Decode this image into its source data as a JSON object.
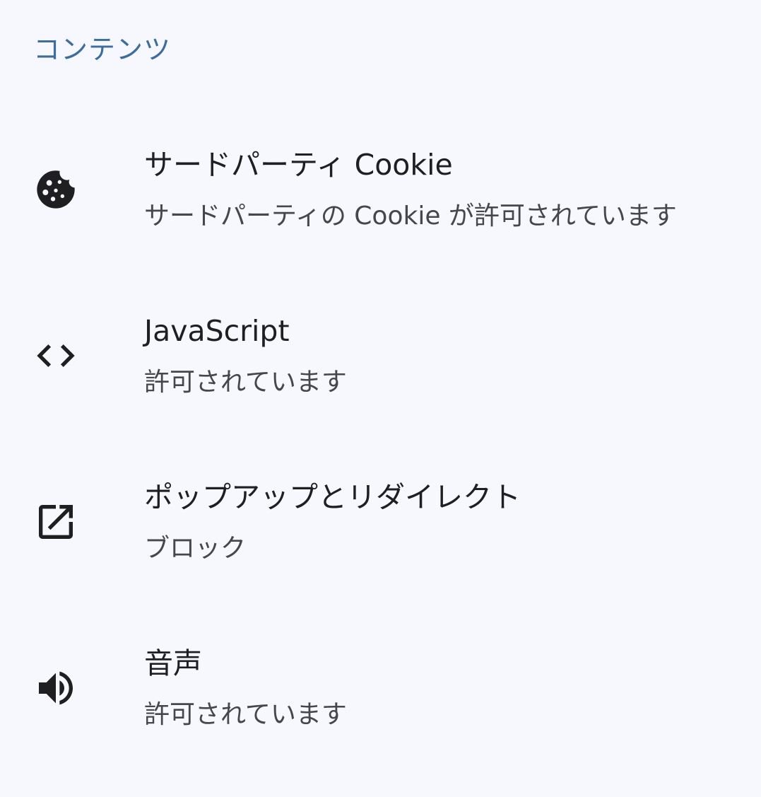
{
  "section": {
    "title": "コンテンツ"
  },
  "items": [
    {
      "icon": "cookie-icon",
      "title": "サードパーティ Cookie",
      "subtitle": "サードパーティの Cookie が許可されています"
    },
    {
      "icon": "code-icon",
      "title": "JavaScript",
      "subtitle": "許可されています"
    },
    {
      "icon": "open-in-new-icon",
      "title": "ポップアップとリダイレクト",
      "subtitle": "ブロック"
    },
    {
      "icon": "volume-up-icon",
      "title": "音声",
      "subtitle": "許可されています"
    }
  ],
  "colors": {
    "background": "#f7f8fd",
    "section_header": "#3d6ca0",
    "title_text": "#1f1f21",
    "subtitle_text": "#46474c",
    "icon": "#1f1f21"
  }
}
